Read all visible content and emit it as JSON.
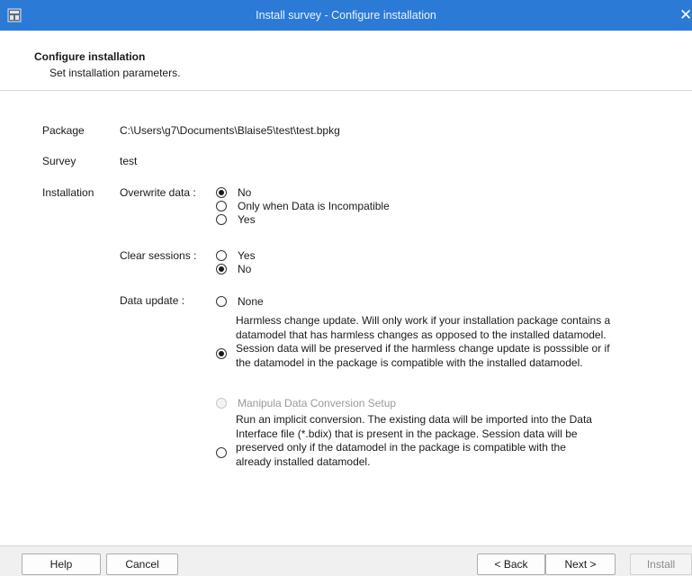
{
  "window": {
    "title": "Install survey - Configure installation",
    "close_glyph": "✕"
  },
  "header": {
    "title": "Configure installation",
    "subtitle": "Set installation parameters."
  },
  "fields": {
    "package_label": "Package",
    "package_value": "C:\\Users\\g7\\Documents\\Blaise5\\test\\test.bpkg",
    "survey_label": "Survey",
    "survey_value": "test",
    "installation_label": "Installation"
  },
  "overwrite": {
    "label": "Overwrite data :",
    "options": [
      "No",
      "Only when Data is Incompatible",
      "Yes"
    ],
    "selected": "No"
  },
  "clear_sessions": {
    "label": "Clear sessions :",
    "options": [
      "Yes",
      "No"
    ],
    "selected": "No"
  },
  "data_update": {
    "label": "Data update :",
    "none": "None",
    "harmless": [
      "Harmless change update. Will only work if your installation package contains a",
      "datamodel that has harmless changes as opposed to the installed datamodel.",
      "Session data will be preserved if the harmless change update is posssible or if",
      "the datamodel in the package is compatible with the installed datamodel."
    ],
    "manipula": "Manipula Data Conversion Setup",
    "implicit": [
      "Run an implicit conversion. The existing data will be imported into the Data",
      "Interface file (*.bdix) that is present in the package. Session data will be",
      "preserved only if the datamodel in the package is compatible with the",
      "already installed datamodel."
    ],
    "selected": "harmless"
  },
  "buttons": {
    "help": "Help",
    "cancel": "Cancel",
    "back": "< Back",
    "next": "Next >",
    "install": "Install"
  },
  "colors": {
    "titlebar": "#2b7ad6",
    "content_bg": "#ffffff",
    "footer_bg": "#f0f0f0"
  }
}
